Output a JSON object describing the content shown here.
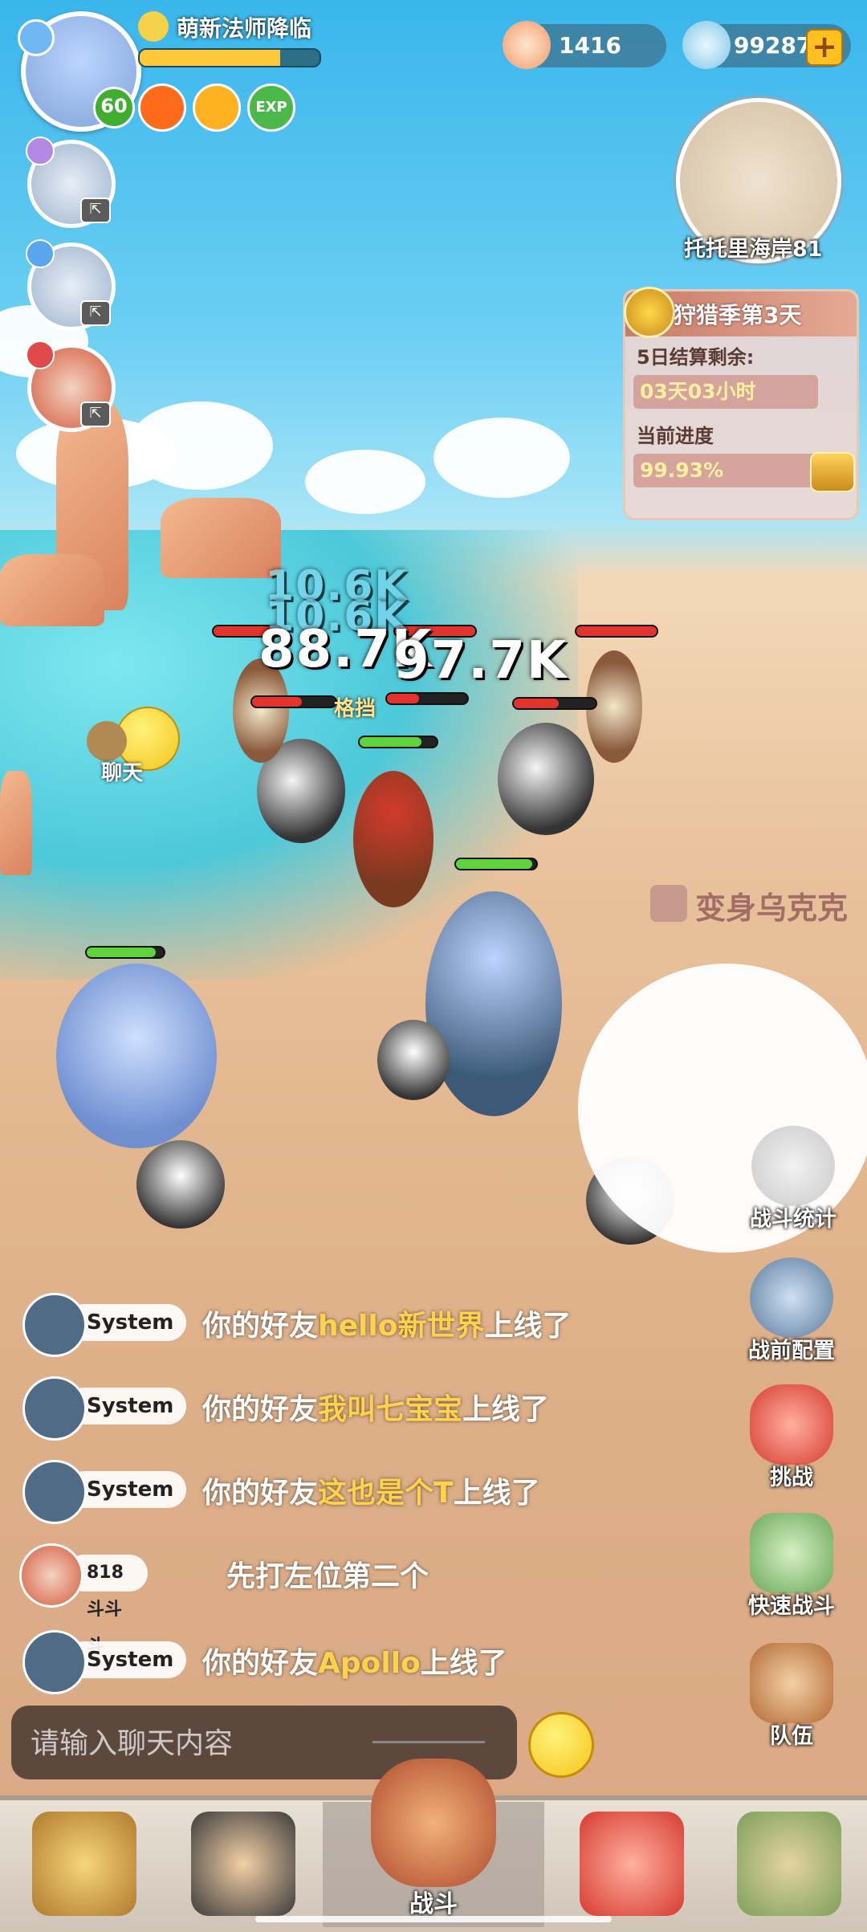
{
  "player": {
    "name": "萌新法师降临",
    "level": "60",
    "xp_progress": 0.78,
    "buffs": [
      "fire-buff-icon",
      "pet-buff-icon",
      "EXP"
    ]
  },
  "currencies": {
    "shells": "1416",
    "crystals": "992870"
  },
  "map": {
    "name": "托托里海岸81"
  },
  "hunting": {
    "title": "狩猎季第3天",
    "remaining_label": "5日结算剩余:",
    "remaining_value": "03天03小时",
    "progress_label": "当前进度",
    "progress_value": "99.93%"
  },
  "battle": {
    "damage_numbers": [
      "10.6K",
      "10.6K",
      "88.7K",
      "97.7K"
    ],
    "block_text": "格挡",
    "transform_text": "变身乌克克",
    "chat_bubble_label": "聊天"
  },
  "side_buttons": {
    "battle_stats": "战斗统计",
    "pre_battle_config": "战前配置",
    "challenge": "挑战",
    "quick_battle": "快速战斗",
    "team": "队伍"
  },
  "chat": {
    "messages": [
      {
        "sender": "System",
        "pre": "你的好友",
        "highlight": "hello新世界",
        "post": "上线了"
      },
      {
        "sender": "System",
        "pre": "你的好友",
        "highlight": "我叫七宝宝",
        "post": "上线了"
      },
      {
        "sender": "System",
        "pre": "你的好友",
        "highlight": "这也是个T",
        "post": "上线了"
      },
      {
        "sender": "818斗斗斗",
        "pre": "先打左位第二个",
        "highlight": "",
        "post": ""
      },
      {
        "sender": "System",
        "pre": "你的好友",
        "highlight": "Apollo",
        "post": "上线了"
      }
    ],
    "input_placeholder": "请输入聊天内容"
  },
  "bottom_nav": {
    "center_label": "战斗"
  },
  "colors": {
    "highlight": "#ffd24a",
    "hp_green": "#5fd33b",
    "hp_red": "#e2342c",
    "xp_yellow": "#ffc83a"
  }
}
